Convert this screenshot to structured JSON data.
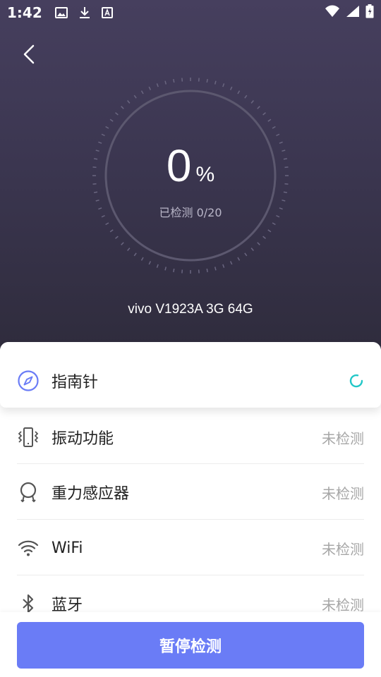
{
  "status_bar": {
    "time": "1:42"
  },
  "progress": {
    "percent_value": "0",
    "percent_sign": "%",
    "checked_text": "已检测 0/20",
    "fraction": 0
  },
  "device": {
    "name": "vivo V1923A 3G 64G"
  },
  "items": [
    {
      "label": "指南针",
      "status": "",
      "state": "checking"
    },
    {
      "label": "振动功能",
      "status": "未检测"
    },
    {
      "label": "重力感应器",
      "status": "未检测"
    },
    {
      "label": "WiFi",
      "status": "未检测"
    },
    {
      "label": "蓝牙",
      "status": "未检测"
    }
  ],
  "action": {
    "label": "暂停检测"
  },
  "colors": {
    "accent": "#6a7cf6",
    "spinner": "#22c7c7",
    "header_top": "#463f5e",
    "header_bottom": "#2e2b3b"
  }
}
